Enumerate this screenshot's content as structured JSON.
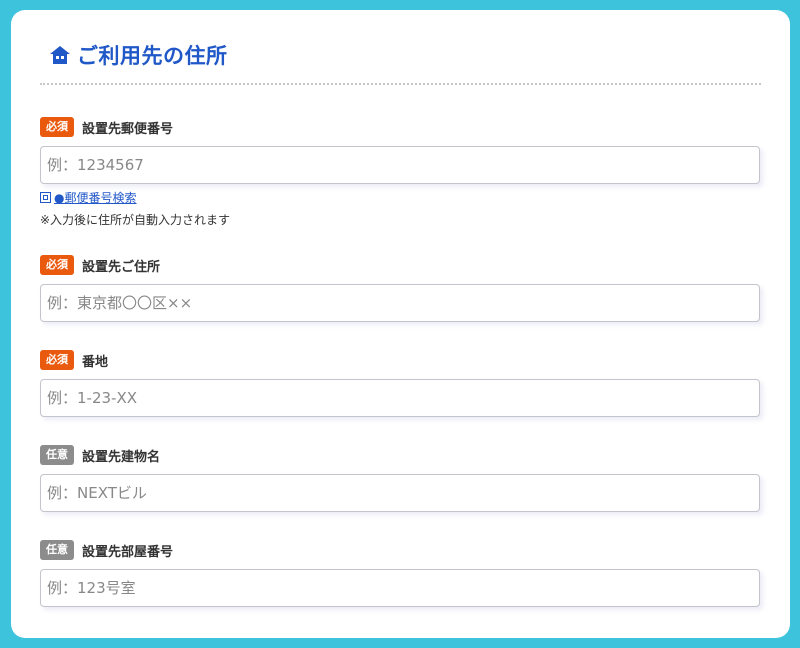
{
  "header": {
    "title": "ご利用先の住所",
    "icon": "house-icon"
  },
  "colors": {
    "background": "#3ec3dc",
    "title": "#2158c8",
    "required_badge": "#ea5a0e",
    "optional_badge": "#8c8c8c"
  },
  "fields": [
    {
      "badge": "必須",
      "label": "設置先郵便番号",
      "placeholder": "例：1234567",
      "value": "",
      "helper_link": "●郵便番号検索",
      "helper_note": "※入力後に住所が自動入力されます"
    },
    {
      "badge": "必須",
      "label": "設置先ご住所",
      "placeholder": "例：東京都〇〇区××",
      "value": ""
    },
    {
      "badge": "必須",
      "label": "番地",
      "placeholder": "例：1-23-XX",
      "value": ""
    },
    {
      "badge": "任意",
      "label": "設置先建物名",
      "placeholder": "例：NEXTビル",
      "value": ""
    },
    {
      "badge": "任意",
      "label": "設置先部屋番号",
      "placeholder": "例：123号室",
      "value": ""
    }
  ]
}
